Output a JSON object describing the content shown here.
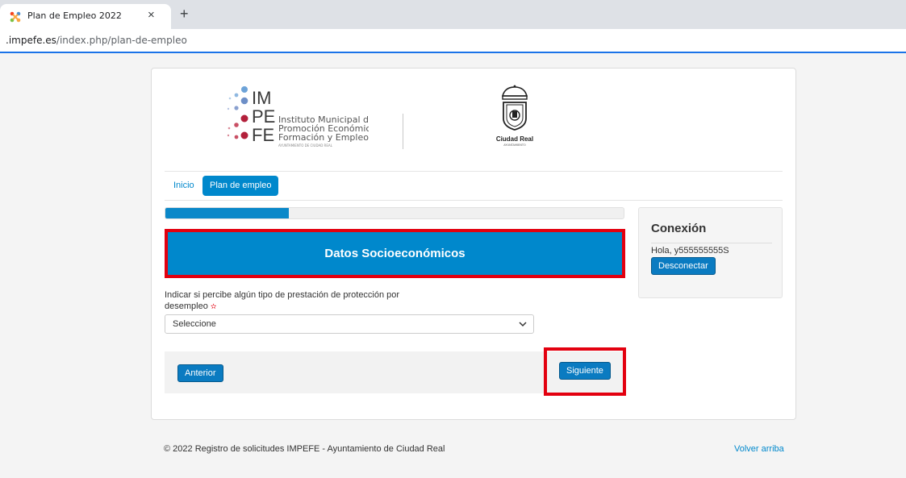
{
  "browser": {
    "tab_title": "Plan de Empleo 2022",
    "tab_close": "×",
    "new_tab": "+",
    "url_host": ".impefe.es",
    "url_path": "/index.php/plan-de-empleo"
  },
  "header": {
    "impefe_logo": {
      "line1": "IM",
      "line2": "PE",
      "line3": "FE",
      "name_line1": "Instituto Municipal de",
      "name_line2": "Promoción Económica",
      "name_line3": "Formación y Empleo",
      "sub": "AYUNTAMIENTO DE CIUDAD REAL"
    },
    "cr_logo": {
      "name": "Ciudad Real",
      "sub": "AYUNTAMIENTO"
    }
  },
  "nav": {
    "items": [
      {
        "label": "Inicio"
      },
      {
        "label": "Plan de empleo",
        "active": true
      }
    ]
  },
  "form": {
    "progress_fraction": 0.27,
    "section_title": "Datos Socioeconómicos",
    "question_label": "Indicar si percibe algún tipo de prestación de protección por desempleo",
    "required_mark": "✫",
    "select_value": "Seleccione",
    "prev_button": "Anterior",
    "next_button": "Siguiente"
  },
  "sidebar": {
    "title": "Conexión",
    "greeting": "Hola, y555555555S",
    "logout_button": "Desconectar"
  },
  "footer": {
    "copyright": "© 2022 Registro de solicitudes IMPEFE - Ayuntamiento de Ciudad Real",
    "back_to_top": "Volver arriba"
  },
  "colors": {
    "primary": "#0088cc",
    "highlight": "#e3000f",
    "logo_red": "#b3203b",
    "logo_blue": "#6da3d8"
  }
}
